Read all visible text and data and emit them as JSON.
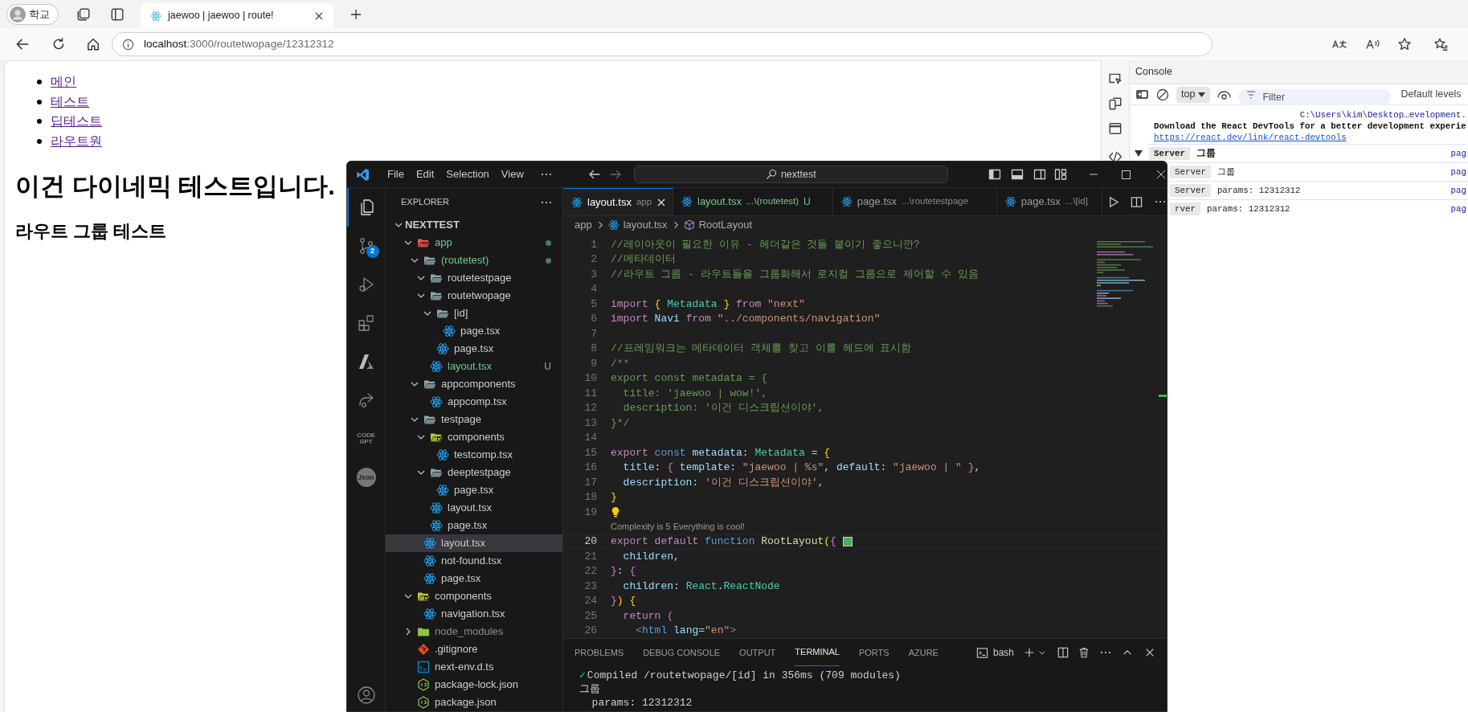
{
  "browser": {
    "profile": "학교",
    "tab_title": "jaewoo | jaewoo | route!",
    "url_host": "localhost",
    "url_path": ":3000/routetwopage/12312312"
  },
  "page": {
    "nav_links": [
      "메인",
      "테스트",
      "딥테스트",
      "라우트원"
    ],
    "heading": "이건 다이네믹 테스트입니다.",
    "subheading": "라우트 그룹 테스트"
  },
  "devtools": {
    "title": "Console",
    "context": "top",
    "filter": {
      "placeholder": "Filter"
    },
    "levels": "Default levels",
    "source": "C:\\Users\\kim\\Desktop…evelopment.",
    "message": "Download the React DevTools for a better development experie",
    "link": "https://react.dev/link/react-devtools",
    "logs": [
      {
        "badge": "Server",
        "text": "그룹",
        "source": "pag",
        "expanded": true,
        "children": [
          {
            "badge": "Server",
            "text": "그룹",
            "source": "pag"
          },
          {
            "badge": "Server",
            "text": "params: 12312312",
            "source": "pag"
          },
          {
            "badge": "rver",
            "text": "params: 12312312",
            "source": "pag"
          }
        ]
      }
    ]
  },
  "vscode": {
    "menu": [
      "File",
      "Edit",
      "Selection",
      "View"
    ],
    "search": "nexttest",
    "activity": [
      {
        "kind": "explorer",
        "selected": true
      },
      {
        "kind": "source-control",
        "selected": false,
        "badge": "2"
      },
      {
        "kind": "run",
        "selected": false
      },
      {
        "kind": "extensions",
        "selected": false
      },
      {
        "kind": "azure",
        "selected": false
      },
      {
        "kind": "share",
        "selected": false
      },
      {
        "kind": "label",
        "selected": false,
        "label": "CODE GPT"
      },
      {
        "kind": "circle-label",
        "selected": false,
        "label": "Json"
      }
    ],
    "explorer": {
      "title": "EXPLORER",
      "root": {
        "name": "NEXTTEST",
        "expanded": true,
        "children": [
          {
            "name": "app",
            "kind": "app-folder",
            "expanded": true,
            "selected": false,
            "modified": true,
            "ignored": false,
            "children": [
              {
                "name": "(routetest)",
                "kind": "folder",
                "expanded": true,
                "selected": false,
                "modified": true,
                "ignored": false,
                "children": [
                  {
                    "name": "routetestpage",
                    "kind": "folder",
                    "expanded": true,
                    "selected": false,
                    "modified": false,
                    "ignored": false
                  },
                  {
                    "name": "routetwopage",
                    "kind": "folder",
                    "expanded": true,
                    "selected": false,
                    "modified": false,
                    "ignored": false,
                    "children": [
                      {
                        "name": "[id]",
                        "kind": "folder",
                        "expanded": true,
                        "selected": false,
                        "modified": false,
                        "ignored": false,
                        "children": [
                          {
                            "name": "page.tsx",
                            "kind": "react",
                            "selected": false,
                            "modified": false,
                            "ignored": false
                          }
                        ]
                      },
                      {
                        "name": "page.tsx",
                        "kind": "react",
                        "selected": false,
                        "modified": false,
                        "ignored": false
                      }
                    ]
                  },
                  {
                    "name": "layout.tsx",
                    "kind": "react",
                    "selected": false,
                    "modified": false,
                    "ignored": false,
                    "decoration": "U"
                  }
                ]
              },
              {
                "name": "appcomponents",
                "kind": "folder",
                "expanded": true,
                "selected": false,
                "modified": false,
                "ignored": false,
                "children": [
                  {
                    "name": "appcomp.tsx",
                    "kind": "react",
                    "selected": false,
                    "modified": false,
                    "ignored": false
                  }
                ]
              },
              {
                "name": "testpage",
                "kind": "folder",
                "expanded": true,
                "selected": false,
                "modified": false,
                "ignored": false,
                "children": [
                  {
                    "name": "components",
                    "kind": "components-folder",
                    "expanded": true,
                    "selected": false,
                    "modified": false,
                    "ignored": false,
                    "children": [
                      {
                        "name": "testcomp.tsx",
                        "kind": "react",
                        "selected": false,
                        "modified": false,
                        "ignored": false
                      }
                    ]
                  },
                  {
                    "name": "deeptestpage",
                    "kind": "folder",
                    "expanded": true,
                    "selected": false,
                    "modified": false,
                    "ignored": false,
                    "children": [
                      {
                        "name": "page.tsx",
                        "kind": "react",
                        "selected": false,
                        "modified": false,
                        "ignored": false
                      }
                    ]
                  },
                  {
                    "name": "layout.tsx",
                    "kind": "react",
                    "selected": false,
                    "modified": false,
                    "ignored": false
                  },
                  {
                    "name": "page.tsx",
                    "kind": "react",
                    "selected": false,
                    "modified": false,
                    "ignored": false
                  }
                ]
              },
              {
                "name": "layout.tsx",
                "kind": "react",
                "selected": true,
                "modified": false,
                "ignored": false
              },
              {
                "name": "not-found.tsx",
                "kind": "react",
                "selected": false,
                "modified": false,
                "ignored": false
              },
              {
                "name": "page.tsx",
                "kind": "react",
                "selected": false,
                "modified": false,
                "ignored": false
              }
            ]
          },
          {
            "name": "components",
            "kind": "components-folder",
            "expanded": true,
            "selected": false,
            "modified": false,
            "ignored": false,
            "children": [
              {
                "name": "navigation.tsx",
                "kind": "react",
                "selected": false,
                "modified": false,
                "ignored": false
              }
            ]
          },
          {
            "name": "node_modules",
            "kind": "node-folder",
            "expanded": false,
            "selected": false,
            "modified": false,
            "ignored": true
          },
          {
            "name": ".gitignore",
            "kind": "git",
            "selected": false,
            "modified": false,
            "ignored": false
          },
          {
            "name": "next-env.d.ts",
            "kind": "ts",
            "selected": false,
            "modified": false,
            "ignored": false
          },
          {
            "name": "package-lock.json",
            "kind": "node",
            "selected": false,
            "modified": false,
            "ignored": false
          },
          {
            "name": "package.json",
            "kind": "node",
            "selected": false,
            "modified": false,
            "ignored": false
          }
        ]
      }
    },
    "tabs": [
      {
        "name": "layout.tsx",
        "description": "app",
        "selected": true
      },
      {
        "name": "layout.tsx",
        "description": "...\\(routetest)",
        "selected": false,
        "decoration": "U"
      },
      {
        "name": "page.tsx",
        "description": "...\\routetestpage",
        "selected": false
      },
      {
        "name": "page.tsx",
        "description": "...\\[id]",
        "selected": false
      }
    ],
    "breadcrumb": [
      "app",
      "layout.tsx",
      "RootLayout"
    ],
    "code": [
      {
        "number": "1",
        "current": false,
        "tokens": [
          {
            "text": "//레이아웃이 필요한 이유 - 헤더같은 것들 붙이기 좋으니깐?",
            "kind": "comment"
          }
        ]
      },
      {
        "number": "2",
        "current": false,
        "tokens": [
          {
            "text": "//메타데이터",
            "kind": "comment"
          }
        ]
      },
      {
        "number": "3",
        "current": false,
        "tokens": [
          {
            "text": "//라우트 그룹 - 라우트들을 그룹화해서 로지컬 그룹으로 제어할 수 있음",
            "kind": "comment"
          }
        ]
      },
      {
        "number": "4",
        "current": false
      },
      {
        "number": "5",
        "current": false,
        "tokens": [
          {
            "text": "import ",
            "kind": "keyword"
          },
          {
            "text": "{",
            "kind": "bracket1"
          },
          {
            "text": " Metadata ",
            "kind": "type"
          },
          {
            "text": "}",
            "kind": "bracket1"
          },
          {
            "text": " from ",
            "kind": "keyword"
          },
          {
            "text": "\"next\"",
            "kind": "string"
          }
        ]
      },
      {
        "number": "6",
        "current": false,
        "tokens": [
          {
            "text": "import ",
            "kind": "keyword"
          },
          {
            "text": "Navi",
            "kind": "variable"
          },
          {
            "text": " from ",
            "kind": "keyword"
          },
          {
            "text": "\"../components/navigation\"",
            "kind": "string"
          }
        ]
      },
      {
        "number": "7",
        "current": false
      },
      {
        "number": "8",
        "current": false,
        "tokens": [
          {
            "text": "//프레임워크는 메타데이터 객체를 찾고 이를 헤드에 표시함",
            "kind": "comment"
          }
        ]
      },
      {
        "number": "9",
        "current": false,
        "tokens": [
          {
            "text": "/**",
            "kind": "comment"
          }
        ]
      },
      {
        "number": "10",
        "current": false,
        "tokens": [
          {
            "text": "export const metadata = {",
            "kind": "comment"
          }
        ]
      },
      {
        "number": "11",
        "current": false,
        "tokens": [
          {
            "text": "  title: 'jaewoo | wow!',",
            "kind": "comment"
          }
        ]
      },
      {
        "number": "12",
        "current": false,
        "tokens": [
          {
            "text": "  description: '이건 디스크립션이야',",
            "kind": "comment"
          }
        ]
      },
      {
        "number": "13",
        "current": false,
        "tokens": [
          {
            "text": "}*/",
            "kind": "comment"
          }
        ]
      },
      {
        "number": "14",
        "current": false
      },
      {
        "number": "15",
        "current": false,
        "tokens": [
          {
            "text": "export ",
            "kind": "keyword"
          },
          {
            "text": "const ",
            "kind": "storage"
          },
          {
            "text": "metadata",
            "kind": "variable"
          },
          {
            "text": ": ",
            "kind": "plain"
          },
          {
            "text": "Metadata",
            "kind": "type"
          },
          {
            "text": " = ",
            "kind": "plain"
          },
          {
            "text": "{",
            "kind": "bracket1"
          }
        ]
      },
      {
        "number": "16",
        "current": false,
        "tokens": [
          {
            "text": "  title",
            "kind": "variable"
          },
          {
            "text": ": ",
            "kind": "plain"
          },
          {
            "text": "{",
            "kind": "bracket2"
          },
          {
            "text": " template",
            "kind": "variable"
          },
          {
            "text": ": ",
            "kind": "plain"
          },
          {
            "text": "\"jaewoo | %s\"",
            "kind": "string"
          },
          {
            "text": ", ",
            "kind": "plain"
          },
          {
            "text": "default",
            "kind": "variable"
          },
          {
            "text": ": ",
            "kind": "plain"
          },
          {
            "text": "\"jaewoo | \"",
            "kind": "string"
          },
          {
            "text": " }",
            "kind": "bracket2"
          },
          {
            "text": ",",
            "kind": "plain"
          }
        ]
      },
      {
        "number": "17",
        "current": false,
        "tokens": [
          {
            "text": "  description",
            "kind": "variable"
          },
          {
            "text": ": ",
            "kind": "plain"
          },
          {
            "text": "'이건 디스크립션이야'",
            "kind": "string"
          },
          {
            "text": ",",
            "kind": "plain"
          }
        ]
      },
      {
        "number": "18",
        "current": false,
        "tokens": [
          {
            "text": "}",
            "kind": "bracket1"
          }
        ]
      },
      {
        "number": "19",
        "current": false,
        "lightbulb": true
      },
      {
        "number": "20",
        "current": true,
        "codelens": "Complexity is 5 Everything is cool!",
        "swatch": true,
        "tokens": [
          {
            "text": "export default ",
            "kind": "keyword"
          },
          {
            "text": "function ",
            "kind": "storage"
          },
          {
            "text": "RootLayout",
            "kind": "function"
          },
          {
            "text": "(",
            "kind": "bracket1"
          },
          {
            "text": "{",
            "kind": "bracket2"
          }
        ]
      },
      {
        "number": "21",
        "current": false,
        "tokens": [
          {
            "text": "  children",
            "kind": "variable"
          },
          {
            "text": ",",
            "kind": "plain"
          }
        ]
      },
      {
        "number": "22",
        "current": false,
        "tokens": [
          {
            "text": "}",
            "kind": "bracket2"
          },
          {
            "text": ": ",
            "kind": "plain"
          },
          {
            "text": "{",
            "kind": "bracket2"
          }
        ]
      },
      {
        "number": "23",
        "current": false,
        "tokens": [
          {
            "text": "  children",
            "kind": "variable"
          },
          {
            "text": ": ",
            "kind": "plain"
          },
          {
            "text": "React",
            "kind": "type"
          },
          {
            "text": ".",
            "kind": "plain"
          },
          {
            "text": "ReactNode",
            "kind": "type"
          }
        ]
      },
      {
        "number": "24",
        "current": false,
        "tokens": [
          {
            "text": "}",
            "kind": "bracket2"
          },
          {
            "text": ")",
            "kind": "bracket1"
          },
          {
            "text": " {",
            "kind": "bracket1"
          }
        ]
      },
      {
        "number": "25",
        "current": false,
        "tokens": [
          {
            "text": "  return ",
            "kind": "keyword"
          },
          {
            "text": "(",
            "kind": "bracket2"
          }
        ]
      },
      {
        "number": "26",
        "current": false,
        "tokens": [
          {
            "text": "    <",
            "kind": "tag"
          },
          {
            "text": "html",
            "kind": "storage"
          },
          {
            "text": " lang",
            "kind": "variable"
          },
          {
            "text": "=",
            "kind": "plain"
          },
          {
            "text": "\"en\"",
            "kind": "string"
          },
          {
            "text": ">",
            "kind": "tag"
          }
        ]
      }
    ],
    "panel": {
      "tabs": [
        {
          "label": "PROBLEMS",
          "selected": false
        },
        {
          "label": "DEBUG CONSOLE",
          "selected": false
        },
        {
          "label": "OUTPUT",
          "selected": false
        },
        {
          "label": "TERMINAL",
          "selected": true
        },
        {
          "label": "PORTS",
          "selected": false
        },
        {
          "label": "AZURE",
          "selected": false
        }
      ],
      "shell": "bash",
      "terminal": [
        {
          "mark": "✓",
          "text": "Compiled /routetwopage/[id] in 356ms (709 modules)"
        },
        {
          "text": "그룹"
        },
        {
          "text": "  params: 12312312"
        }
      ]
    }
  }
}
